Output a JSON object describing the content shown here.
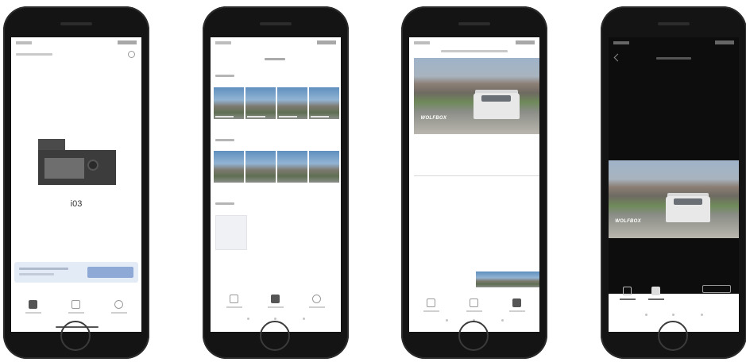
{
  "phones": [
    {
      "screen": "device-list",
      "device_name": "i03"
    },
    {
      "screen": "album"
    },
    {
      "screen": "playback-portrait",
      "video_brand": "WOLFBOX"
    },
    {
      "screen": "playback-dark",
      "video_brand": "WOLFBOX"
    }
  ],
  "colors": {
    "phone_body": "#141414",
    "screen_light": "#ffffff",
    "screen_dark": "#0d0d0d",
    "accent_blue": "#8fa9d6",
    "banner_light": "#e3ebf7"
  },
  "icons": [
    "camera-icon",
    "album-icon",
    "settings-icon",
    "download-icon",
    "share-icon",
    "more-icon"
  ]
}
